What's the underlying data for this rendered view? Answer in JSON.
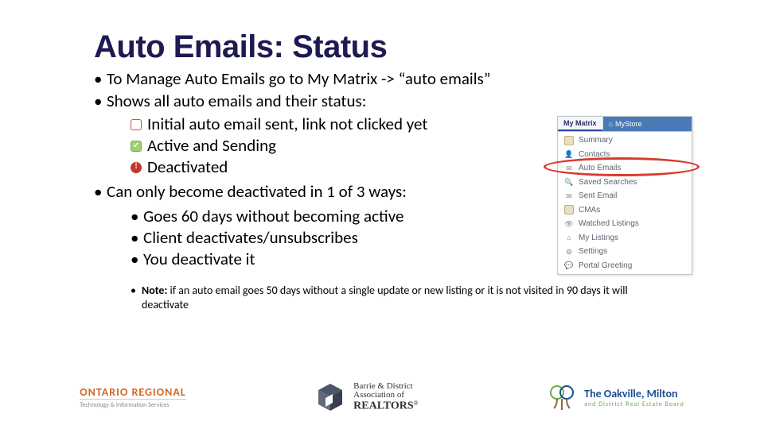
{
  "title": "Auto Emails: Status",
  "bullets": {
    "b1": "To Manage Auto Emails go to My Matrix -> “auto emails”",
    "b2": "Shows all auto emails and their status:",
    "b3": "Can only become deactivated in 1 of 3 ways:"
  },
  "statuses": {
    "s1": "Initial auto email sent, link not clicked yet",
    "s2": "Active and Sending",
    "s3": "Deactivated"
  },
  "ways": {
    "w1": "Goes 60 days without becoming active",
    "w2": "Client deactivates/unsubscribes",
    "w3": "You deactivate it"
  },
  "note": {
    "label": "Note:",
    "text": " if an auto email goes 50 days without a single update or new listing or it is not visited in 90 days it will deactivate"
  },
  "menu": {
    "tab_left": "My Matrix",
    "tab_right": "MyStore",
    "items": {
      "m0": "Summary",
      "m1": "Contacts",
      "m2": "Auto Emails",
      "m3": "Saved Searches",
      "m4": "Sent Email",
      "m5": "CMAs",
      "m6": "Watched Listings",
      "m7": "My Listings",
      "m8": "Settings",
      "m9": "Portal Greeting"
    }
  },
  "logos": {
    "ontario": {
      "line1_a": "ONTARIO ",
      "line1_b": "REGIONAL",
      "line2": "Technology & Information Services"
    },
    "barrie": {
      "line1": "Barrie & District",
      "line2": "Association of",
      "line3": "REALTORS",
      "reg": "®"
    },
    "oakville": {
      "main": "The Oakville, Milton",
      "sub": "and District Real Estate Board"
    }
  }
}
